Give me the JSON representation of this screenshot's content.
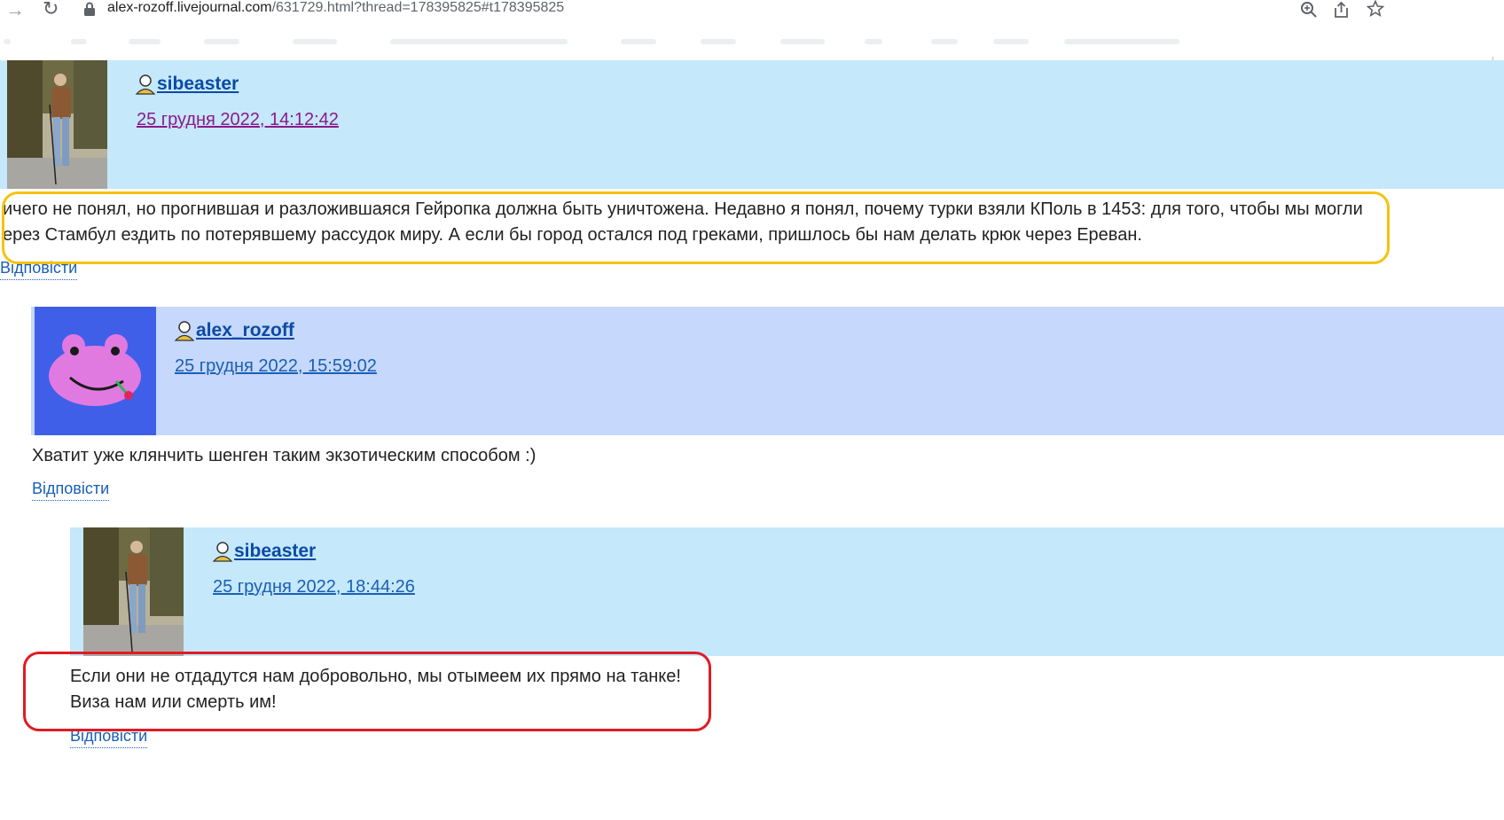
{
  "browser": {
    "url_host": "alex-rozoff.livejournal.com",
    "url_path": "/631729.html?thread=178395825#t178395825"
  },
  "comments": [
    {
      "username": "sibeaster",
      "timestamp": "25 грудня 2022, 14:12:42",
      "lines": [
        "ичего не понял, но прогнившая и разложившаяся Гейропка должна быть уничтожена. Недавно я понял, почему турки взяли КПоль в 1453: для того, чтобы мы могли",
        "ерез Стамбул ездить по потерявшему рассудок миру. А если бы город остался под греками, пришлось бы нам делать крюк через Ереван."
      ],
      "reply": "Відповісти",
      "header_color": "#c5e8fb",
      "highlight_color": "#f5c211"
    },
    {
      "username": "alex_rozoff",
      "timestamp": "25 грудня 2022, 15:59:02",
      "lines": [
        "Хватит уже клянчить шенген таким экзотическим способом :)"
      ],
      "reply": "Відповісти",
      "header_color": "#c6d8fb"
    },
    {
      "username": "sibeaster",
      "timestamp": "25 грудня 2022, 18:44:26",
      "lines": [
        "Если они не отдадутся нам добровольно, мы отымеем их прямо на танке!",
        "Виза нам или смерть им!"
      ],
      "reply": "Відповісти",
      "header_color": "#c5e8fb",
      "highlight_color": "#e01b24"
    }
  ]
}
